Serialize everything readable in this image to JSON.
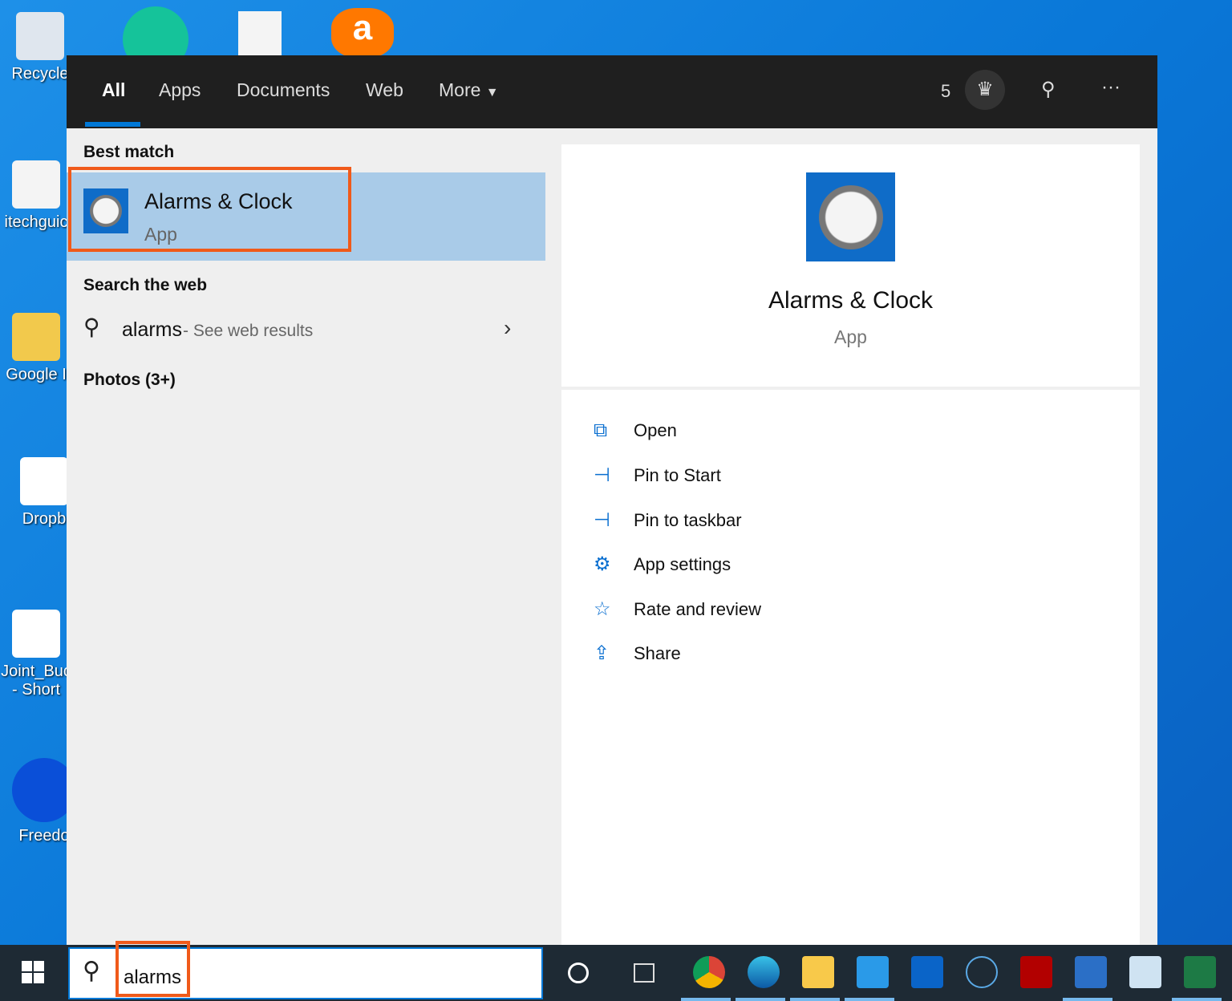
{
  "desktop": {
    "icons": [
      "Recycle",
      "itechguic",
      "Google I",
      "Dropb",
      "Joint_Buc - Short",
      "Freedo"
    ]
  },
  "header": {
    "tabs": [
      "All",
      "Apps",
      "Documents",
      "Web",
      "More"
    ],
    "points": "5"
  },
  "left": {
    "best_match": "Best match",
    "app_name": "Alarms & Clock",
    "app_type": "App",
    "search_web": "Search the web",
    "web_query": "alarms",
    "web_suffix": " - See web results",
    "photos": "Photos (3+)"
  },
  "right": {
    "app_name": "Alarms & Clock",
    "app_type": "App",
    "actions": [
      "Open",
      "Pin to Start",
      "Pin to taskbar",
      "App settings",
      "Rate and review",
      "Share"
    ]
  },
  "taskbar": {
    "search_value": "alarms"
  },
  "colors": {
    "accent": "#0078d7",
    "highlight": "#f05a1a"
  }
}
